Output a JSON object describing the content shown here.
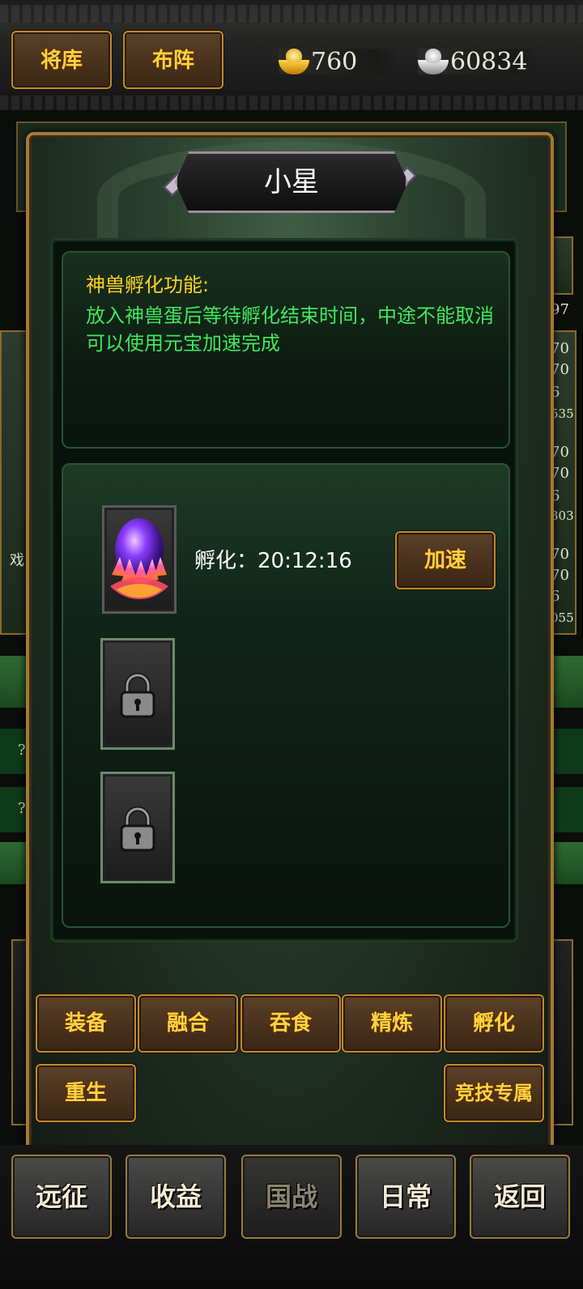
{
  "topbar": {
    "buttons": [
      "将库",
      "布阵"
    ],
    "gold": "760",
    "silver": "60834"
  },
  "background": {
    "right_numbers": [
      "97",
      "70",
      "70",
      "6",
      "535",
      "70",
      "70",
      "6",
      "303",
      "70",
      "70",
      "6",
      "055"
    ],
    "left_labels": [
      "戏",
      "?",
      "?"
    ]
  },
  "modal": {
    "title": "小星",
    "info": {
      "title": "神兽孵化功能:",
      "line1": "放入神兽蛋后等待孵化结束时间，中途不能取消",
      "line2": "可以使用元宝加速完成"
    },
    "hatch": {
      "timer": "孵化：20:12:16",
      "speed_label": "加速"
    },
    "tabs": [
      "装备",
      "融合",
      "吞食",
      "精炼",
      "孵化",
      "重生",
      "竞技专属"
    ]
  },
  "bottom_nav": [
    "远征",
    "收益",
    "国战",
    "日常",
    "返回"
  ],
  "colors": {
    "gold_text": "#ffd23f",
    "info_title": "#ffd21f",
    "info_body": "#3fe85a",
    "frame": "#a07a3a"
  }
}
